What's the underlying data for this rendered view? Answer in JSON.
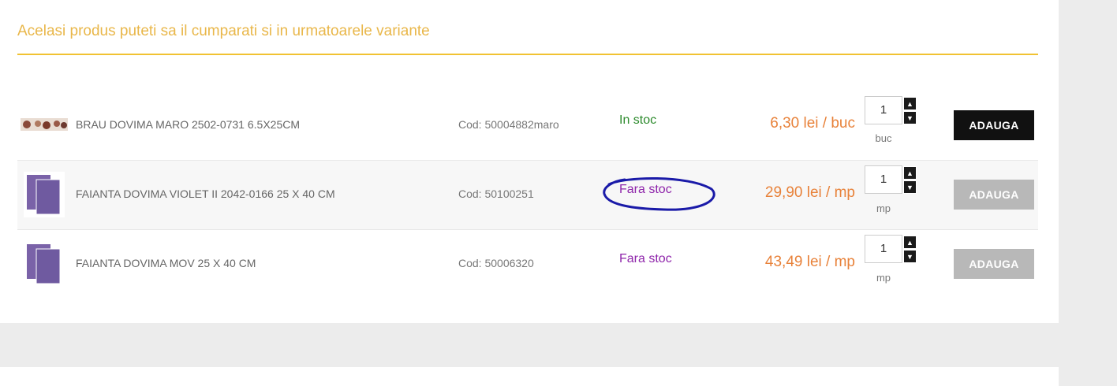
{
  "section": {
    "title": "Acelasi produs puteti sa il cumparati si in urmatoarele variante"
  },
  "products": [
    {
      "name": "BRAU DOVIMA MARO 2502-0731 6.5X25CM",
      "code": "Cod: 50004882maro",
      "stock": "In stoc",
      "price": "6,30 lei / buc",
      "qty": "1",
      "unit": "buc",
      "button": "ADAUGA",
      "in_stock": true
    },
    {
      "name": "FAIANTA DOVIMA VIOLET II 2042-0166 25 X 40 CM",
      "code": "Cod: 50100251",
      "stock": "Fara stoc",
      "price": "29,90 lei / mp",
      "qty": "1",
      "unit": "mp",
      "button": "ADAUGA",
      "in_stock": false
    },
    {
      "name": "FAIANTA DOVIMA MOV 25 X 40 CM",
      "code": "Cod: 50006320",
      "stock": "Fara stoc",
      "price": "43,49 lei / mp",
      "qty": "1",
      "unit": "mp",
      "button": "ADAUGA",
      "in_stock": false
    }
  ],
  "spinner": {
    "up": "▲",
    "down": "▼"
  },
  "colors": {
    "title": "#e9b74a",
    "rule": "#f1c232",
    "price": "#e8823a",
    "in_stock": "#2c8a2c",
    "out_of_stock": "#8e24aa",
    "annotation": "#1a1aa8"
  }
}
